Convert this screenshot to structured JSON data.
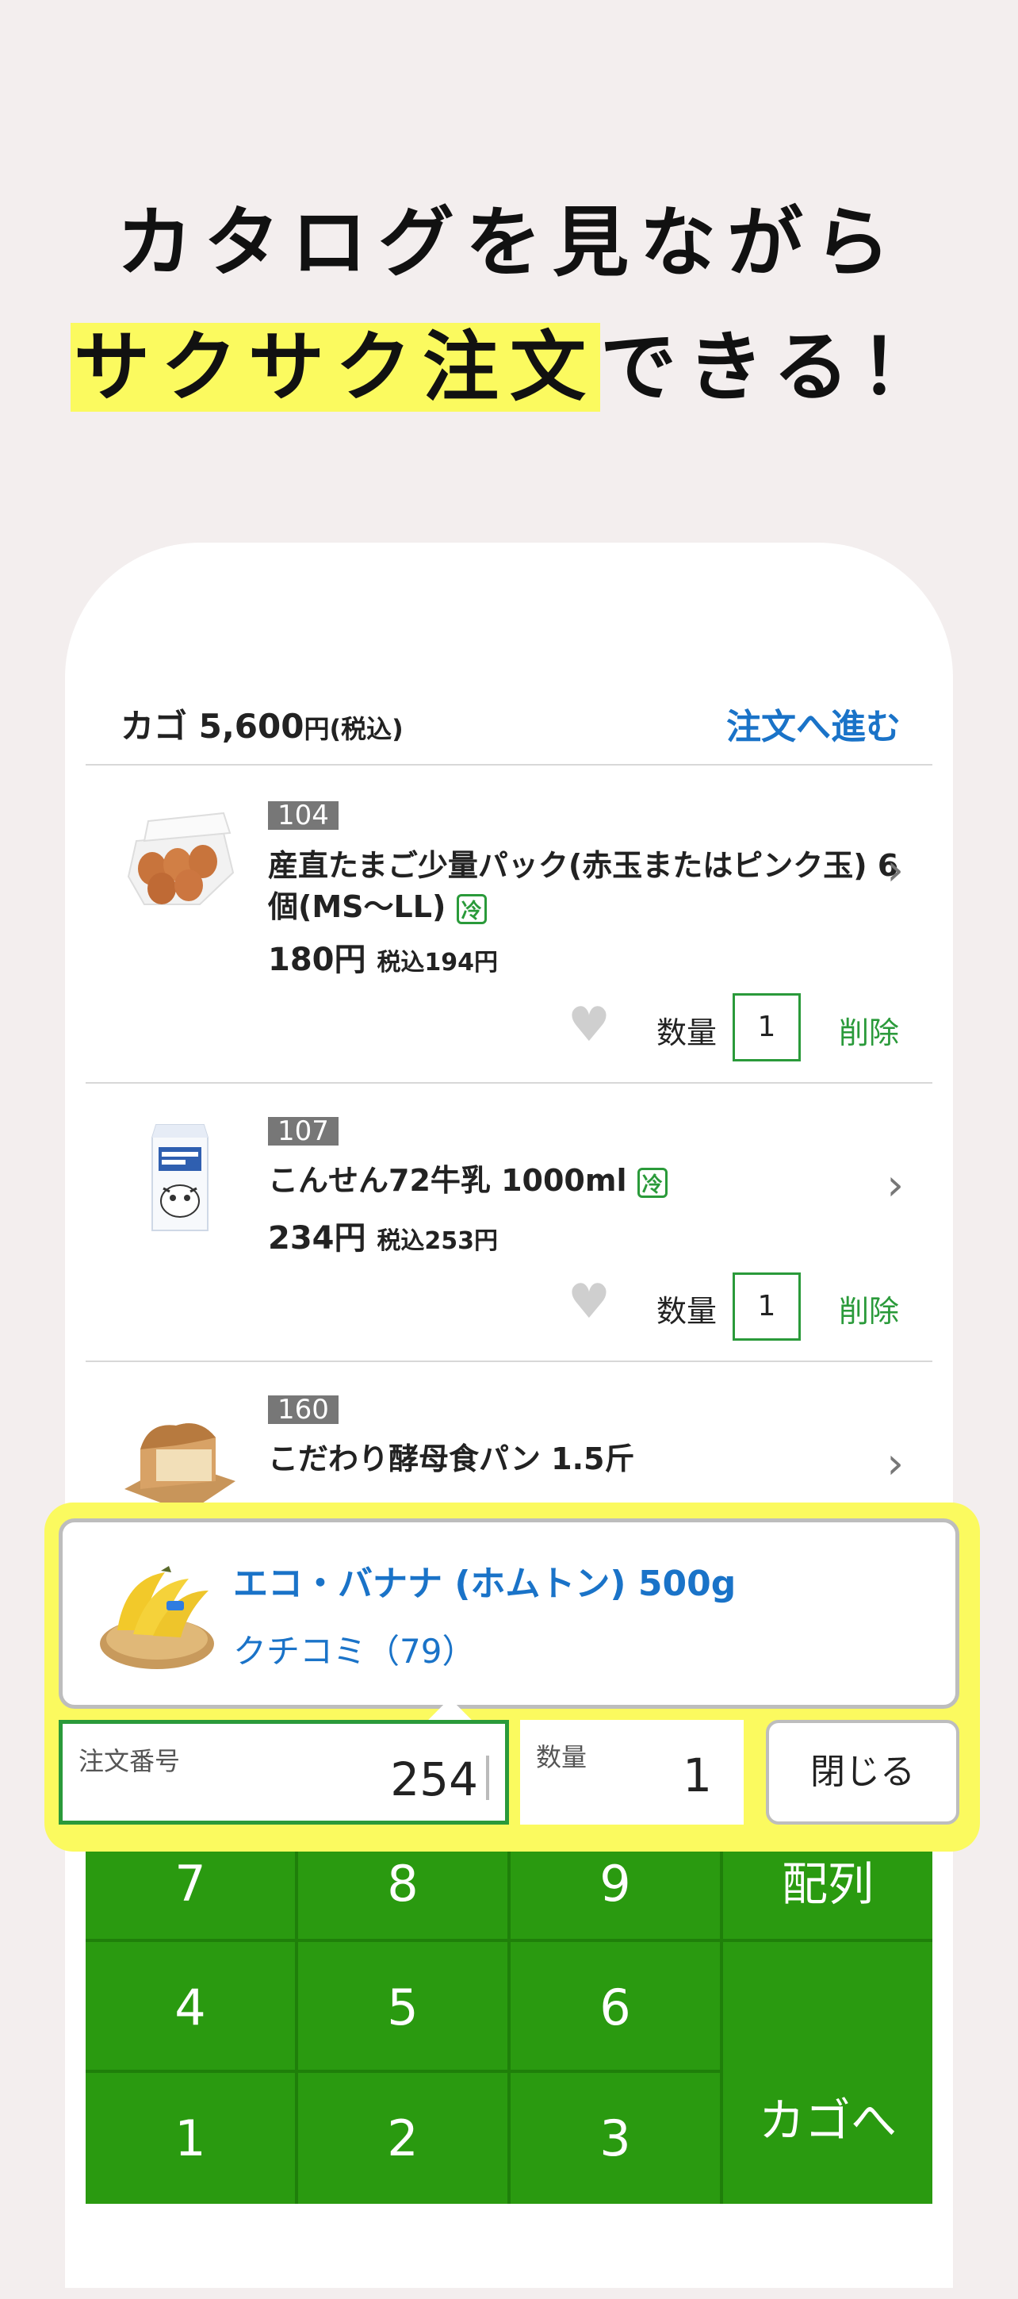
{
  "headline": {
    "line1": "カタログを見ながら",
    "line2_highlight": "サクサク注文",
    "line2_rest": "できる！"
  },
  "cart": {
    "label": "カゴ 5,600",
    "unit": "円(税込)",
    "next_link": "注文へ進む"
  },
  "items": [
    {
      "code": "104",
      "name": "産直たまご少量パック(赤玉またはピンク玉) 6個(MS〜LL)",
      "badge": "冷",
      "price": "180円",
      "tax_price": "税込194円",
      "qty_label": "数量",
      "qty": "1",
      "delete": "削除"
    },
    {
      "code": "107",
      "name": "こんせん72牛乳 1000ml",
      "badge": "冷",
      "price": "234円",
      "tax_price": "税込253円",
      "qty_label": "数量",
      "qty": "1",
      "delete": "削除"
    },
    {
      "code": "160",
      "name": "こだわり酵母食パン 1.5斤"
    }
  ],
  "popup": {
    "product_name": "エコ・バナナ (ホムトン) 500g",
    "reviews": "クチコミ（79）",
    "order_no_label": "注文番号",
    "order_no": "254",
    "qty_label": "数量",
    "qty": "1",
    "close": "閉じる"
  },
  "keypad": {
    "k7": "7",
    "k8": "8",
    "k9": "9",
    "array": "配列",
    "k4": "4",
    "k5": "5",
    "k6": "6",
    "k1": "1",
    "k2": "2",
    "k3": "3",
    "to_cart": "カゴへ"
  },
  "icons": {
    "chevron": "chevron-right-icon",
    "heart": "heart-icon",
    "cool": "refrigerated-badge-icon"
  },
  "colors": {
    "background": "#f3eeee",
    "highlight": "#fbfa5f",
    "link_blue": "#1a73c8",
    "green": "#2a9a10"
  }
}
